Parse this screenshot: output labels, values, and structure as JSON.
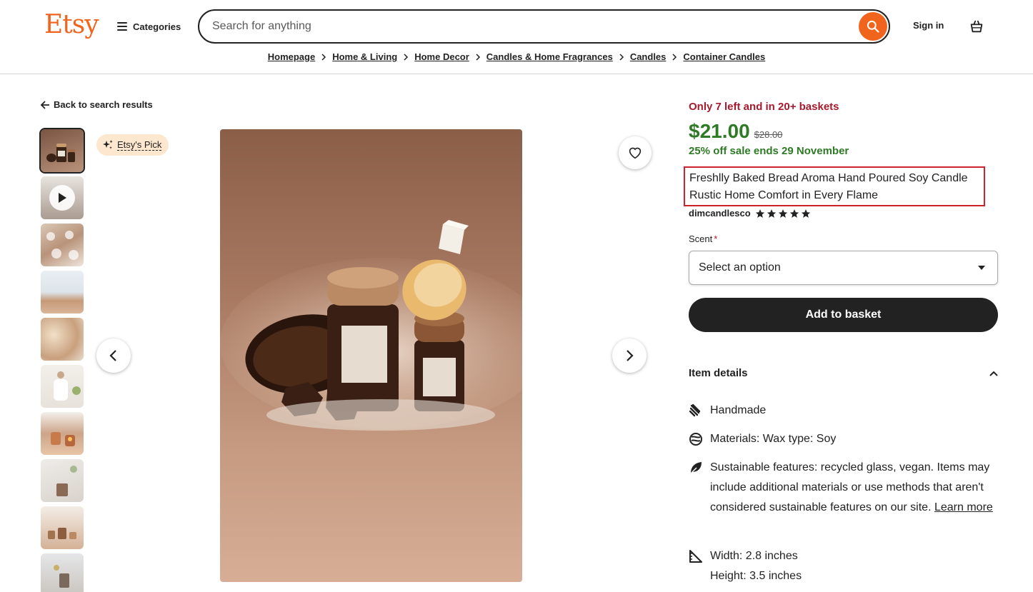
{
  "header": {
    "logo": "Etsy",
    "categories_label": "Categories",
    "search_placeholder": "Search for anything",
    "sign_in": "Sign in"
  },
  "breadcrumb": [
    "Homepage",
    "Home & Living",
    "Home Decor",
    "Candles & Home Fragrances",
    "Candles",
    "Container Candles"
  ],
  "gallery": {
    "back_label": "Back to search results",
    "badge": "Etsy's Pick",
    "thumbnail_count": 10
  },
  "product": {
    "stock_note": "Only 7 left and in 20+ baskets",
    "price": "$21.00",
    "original_price": "$28.00",
    "sale_note": "25% off sale ends 29 November",
    "title": "Freshlly Baked Bread Aroma Hand Poured Soy Candle Rustic Home Comfort in Every Flame",
    "shop_name": "dimcandlesco",
    "rating_stars": 5,
    "scent_label": "Scent",
    "scent_required": "*",
    "scent_placeholder": "Select an option",
    "add_to_basket": "Add to basket"
  },
  "item_details": {
    "heading": "Item details",
    "handmade": "Handmade",
    "materials": "Materials: Wax type: Soy",
    "sustainable": "Sustainable features: recycled glass, vegan. Items may include additional materials or use methods that aren't considered sustainable features on our site.",
    "learn_more": "Learn more",
    "width": "Width: 2.8 inches",
    "height": "Height: 3.5 inches"
  },
  "colors": {
    "brand": "#f1641e",
    "sale_green": "#2f7a26",
    "stock_red": "#a61a2e",
    "highlight_border": "#d0212e"
  }
}
